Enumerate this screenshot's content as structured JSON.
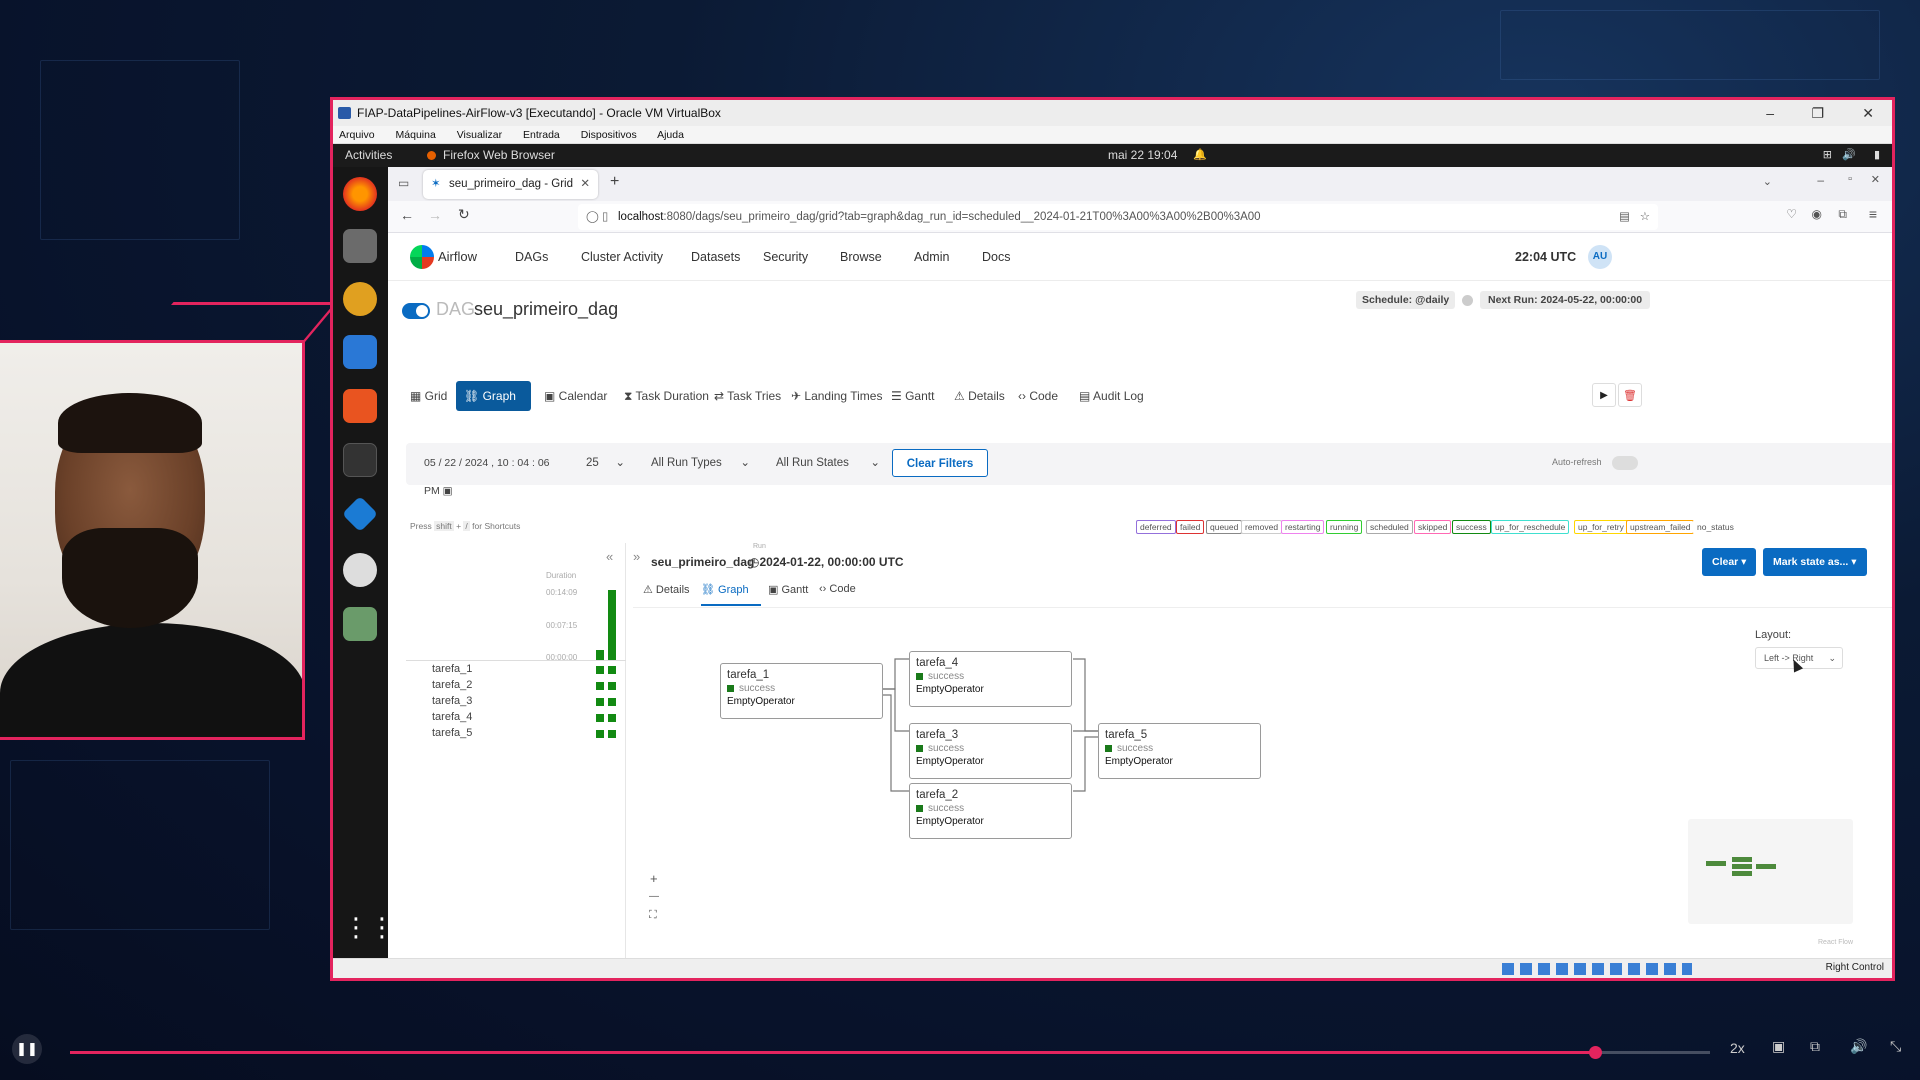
{
  "vbox": {
    "title": "FIAP-DataPipelines-AirFlow-v3 [Executando] - Oracle VM VirtualBox",
    "menu": [
      "Arquivo",
      "Máquina",
      "Visualizar",
      "Entrada",
      "Dispositivos",
      "Ajuda"
    ],
    "host_key": "Right Control"
  },
  "gnome": {
    "activities": "Activities",
    "app": "Firefox Web Browser",
    "clock": "mai 22  19:04"
  },
  "firefox": {
    "tab_title": "seu_primeiro_dag - Grid",
    "url_host": "localhost",
    "url_rest": ":8080/dags/seu_primeiro_dag/grid?tab=graph&dag_run_id=scheduled__2024-01-21T00%3A00%3A00%2B00%3A00"
  },
  "airflow": {
    "brand": "Airflow",
    "nav": [
      "DAGs",
      "Cluster Activity",
      "Datasets",
      "Security",
      "Browse",
      "Admin",
      "Docs"
    ],
    "time": "22:04 UTC",
    "user": "AU",
    "dag_prefix": "DAG:",
    "dag_id": "seu_primeiro_dag",
    "schedule": "Schedule: @daily",
    "next_run": "Next Run: 2024-05-22, 00:00:00",
    "views": [
      "Grid",
      "Graph",
      "Calendar",
      "Task Duration",
      "Task Tries",
      "Landing Times",
      "Gantt",
      "Details",
      "Code",
      "Audit Log"
    ],
    "filters": {
      "date": "05 / 22 / 2024 ,  10 : 04 : 06   PM",
      "runs": "25",
      "run_types": "All Run Types",
      "run_states": "All Run States",
      "clear": "Clear Filters",
      "auto_refresh": "Auto-refresh"
    },
    "shortcuts": {
      "press": "Press",
      "key1": "shift",
      "plus": "+",
      "key2": "/",
      "suffix": "for Shortcuts"
    },
    "states": [
      "deferred",
      "failed",
      "queued",
      "removed",
      "restarting",
      "running",
      "scheduled",
      "skipped",
      "success",
      "up_for_reschedule",
      "up_for_retry",
      "upstream_failed",
      "no_status"
    ],
    "grid": {
      "duration_label": "Duration",
      "ticks": [
        "00:14:09",
        "00:07:15",
        "00:00:00"
      ],
      "tasks": [
        "tarefa_1",
        "tarefa_2",
        "tarefa_3",
        "tarefa_4",
        "tarefa_5"
      ]
    },
    "detail": {
      "dag": "seu_primeiro_dag",
      "run_label": "Run",
      "run": "2024-01-22, 00:00:00 UTC",
      "tabs": [
        "Details",
        "Graph",
        "Gantt",
        "Code"
      ],
      "clear_btn": "Clear",
      "mark_btn": "Mark state as...",
      "layout_label": "Layout:",
      "layout_value": "Left -> Right",
      "react_flow": "React Flow"
    },
    "nodes": [
      {
        "id": "tarefa_1",
        "state": "success",
        "op": "EmptyOperator"
      },
      {
        "id": "tarefa_4",
        "state": "success",
        "op": "EmptyOperator"
      },
      {
        "id": "tarefa_3",
        "state": "success",
        "op": "EmptyOperator"
      },
      {
        "id": "tarefa_2",
        "state": "success",
        "op": "EmptyOperator"
      },
      {
        "id": "tarefa_5",
        "state": "success",
        "op": "EmptyOperator"
      }
    ],
    "zoom": {
      "plus": "+",
      "minus": "—"
    }
  },
  "player": {
    "speed": "2x",
    "progress": 0.93
  },
  "colors": {
    "accent": "#e3245e",
    "airflow_blue": "#0a6bc2",
    "success": "#128a12"
  }
}
